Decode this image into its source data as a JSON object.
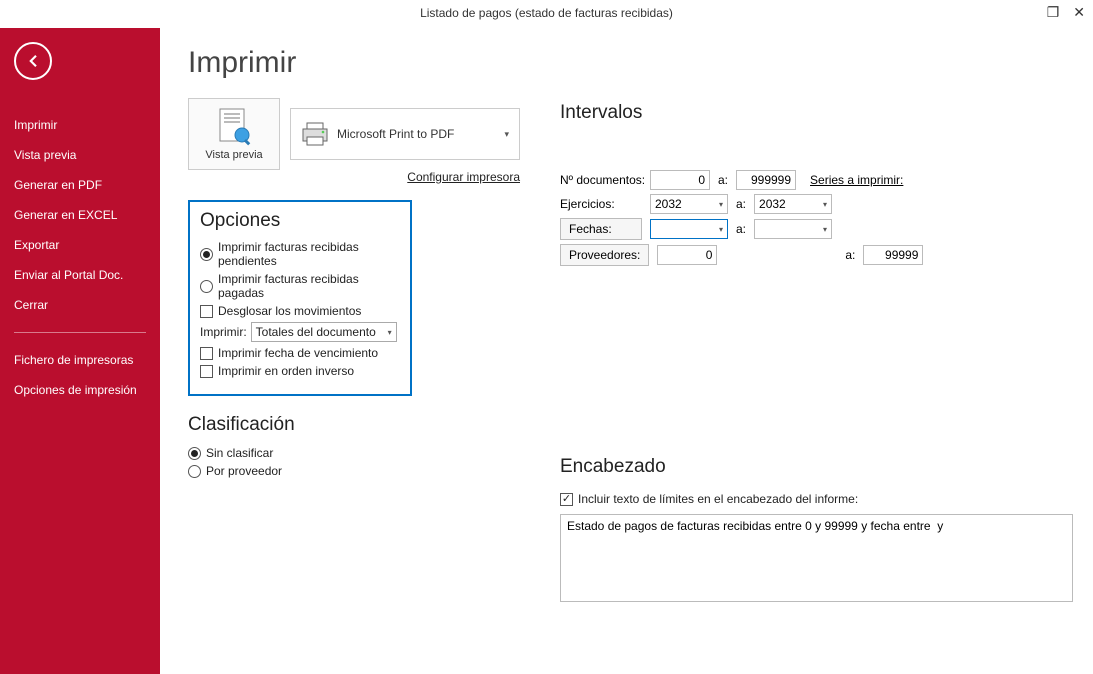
{
  "window_title": "Listado de pagos (estado de facturas recibidas)",
  "sidebar": {
    "items": [
      "Imprimir",
      "Vista previa",
      "Generar en PDF",
      "Generar en EXCEL",
      "Exportar",
      "Enviar al Portal Doc.",
      "Cerrar"
    ],
    "secondary": [
      "Fichero de impresoras",
      "Opciones de impresión"
    ]
  },
  "page_title": "Imprimir",
  "preview_label": "Vista previa",
  "printer_name": "Microsoft Print to PDF",
  "config_printer": "Configurar impresora",
  "opciones": {
    "title": "Opciones",
    "r1": "Imprimir facturas recibidas pendientes",
    "r2": "Imprimir facturas recibidas pagadas",
    "c1": "Desglosar los movimientos",
    "imprimir_label": "Imprimir:",
    "imprimir_value": "Totales del documento",
    "c2": "Imprimir fecha de vencimiento",
    "c3": "Imprimir en orden inverso"
  },
  "clasificacion": {
    "title": "Clasificación",
    "r1": "Sin clasificar",
    "r2": "Por proveedor"
  },
  "intervalos": {
    "title": "Intervalos",
    "n_doc_label": "Nº documentos:",
    "n_doc_from": "0",
    "n_doc_to": "999999",
    "series_link": "Series a imprimir:",
    "ejercicios_label": "Ejercicios:",
    "ej_from": "2032",
    "ej_to": "2032",
    "fechas_label": "Fechas:",
    "fecha_from": "",
    "fecha_to": "",
    "prov_label": "Proveedores:",
    "prov_from": "0",
    "prov_to": "99999",
    "a": "a:"
  },
  "encabezado": {
    "title": "Encabezado",
    "chk_label": "Incluir texto de límites en el encabezado del informe:",
    "text": "Estado de pagos de facturas recibidas entre 0 y 99999 y fecha entre  y"
  }
}
